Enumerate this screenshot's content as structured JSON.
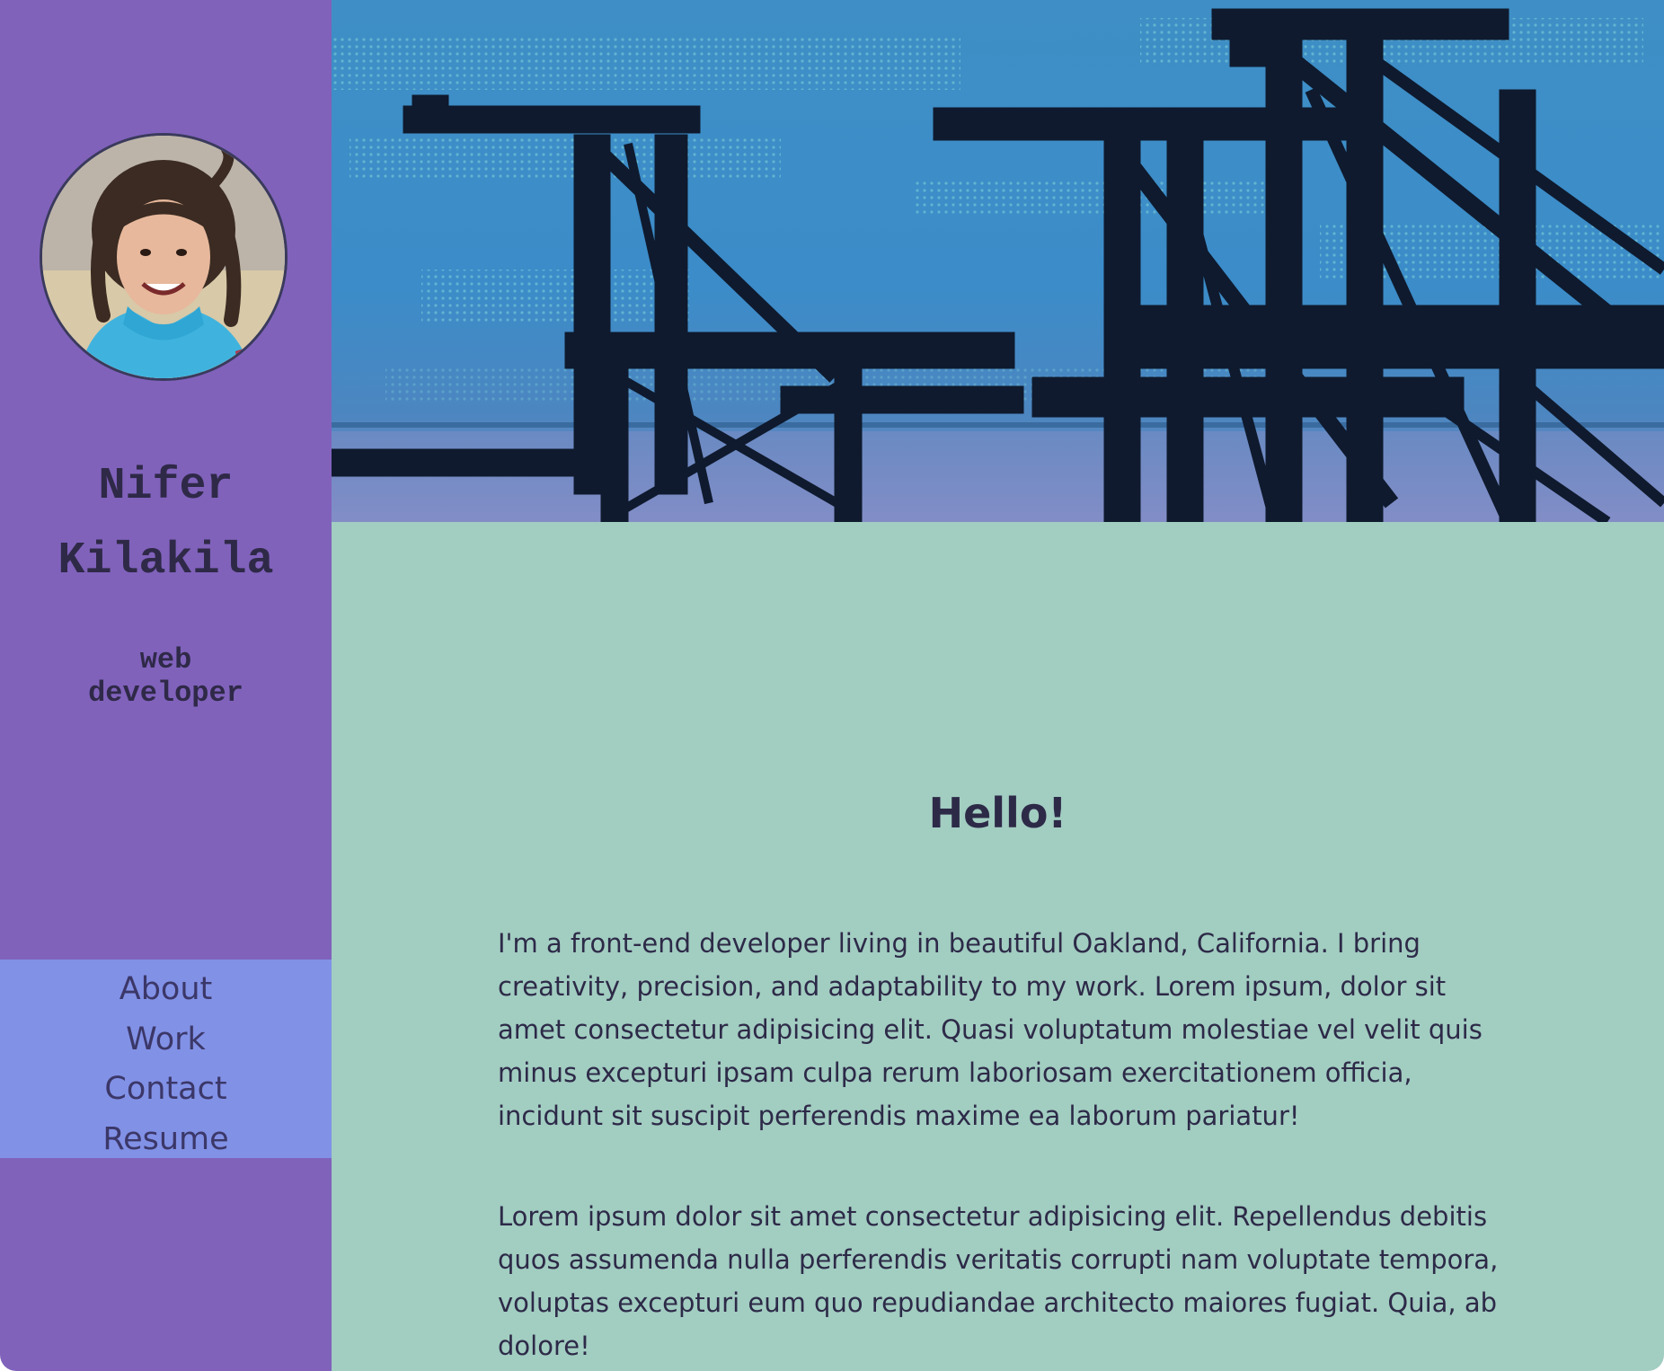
{
  "profile": {
    "name": "Nifer Kilakila",
    "role_line1": "web",
    "role_line2": "developer"
  },
  "nav": {
    "items": [
      {
        "label": "About"
      },
      {
        "label": "Work"
      },
      {
        "label": "Contact"
      },
      {
        "label": "Resume"
      }
    ]
  },
  "main": {
    "heading": "Hello!",
    "paragraphs": [
      "I'm a front-end developer living in beautiful Oakland, California. I bring creativity, precision, and adaptability to my work. Lorem ipsum, dolor sit amet consectetur adipisicing elit. Quasi voluptatum molestiae vel velit quis minus excepturi ipsam culpa rerum laboriosam exercitationem officia, incidunt sit suscipit perferendis maxime ea laborum pariatur!",
      "Lorem ipsum dolor sit amet consectetur adipisicing elit. Repellendus debitis quos assumenda nulla perferendis veritatis corrupti nam voluptate tempora, voluptas excepturi eum quo repudiandae architecto maiores fugiat. Quia, ab dolore!"
    ]
  },
  "colors": {
    "sidebar": "#8062bb",
    "nav_background": "#8191e6",
    "content_background": "#a2cdc1",
    "text": "#2d2a48"
  },
  "icons": {
    "hero": "crane-silhouette-image",
    "avatar": "profile-photo"
  }
}
